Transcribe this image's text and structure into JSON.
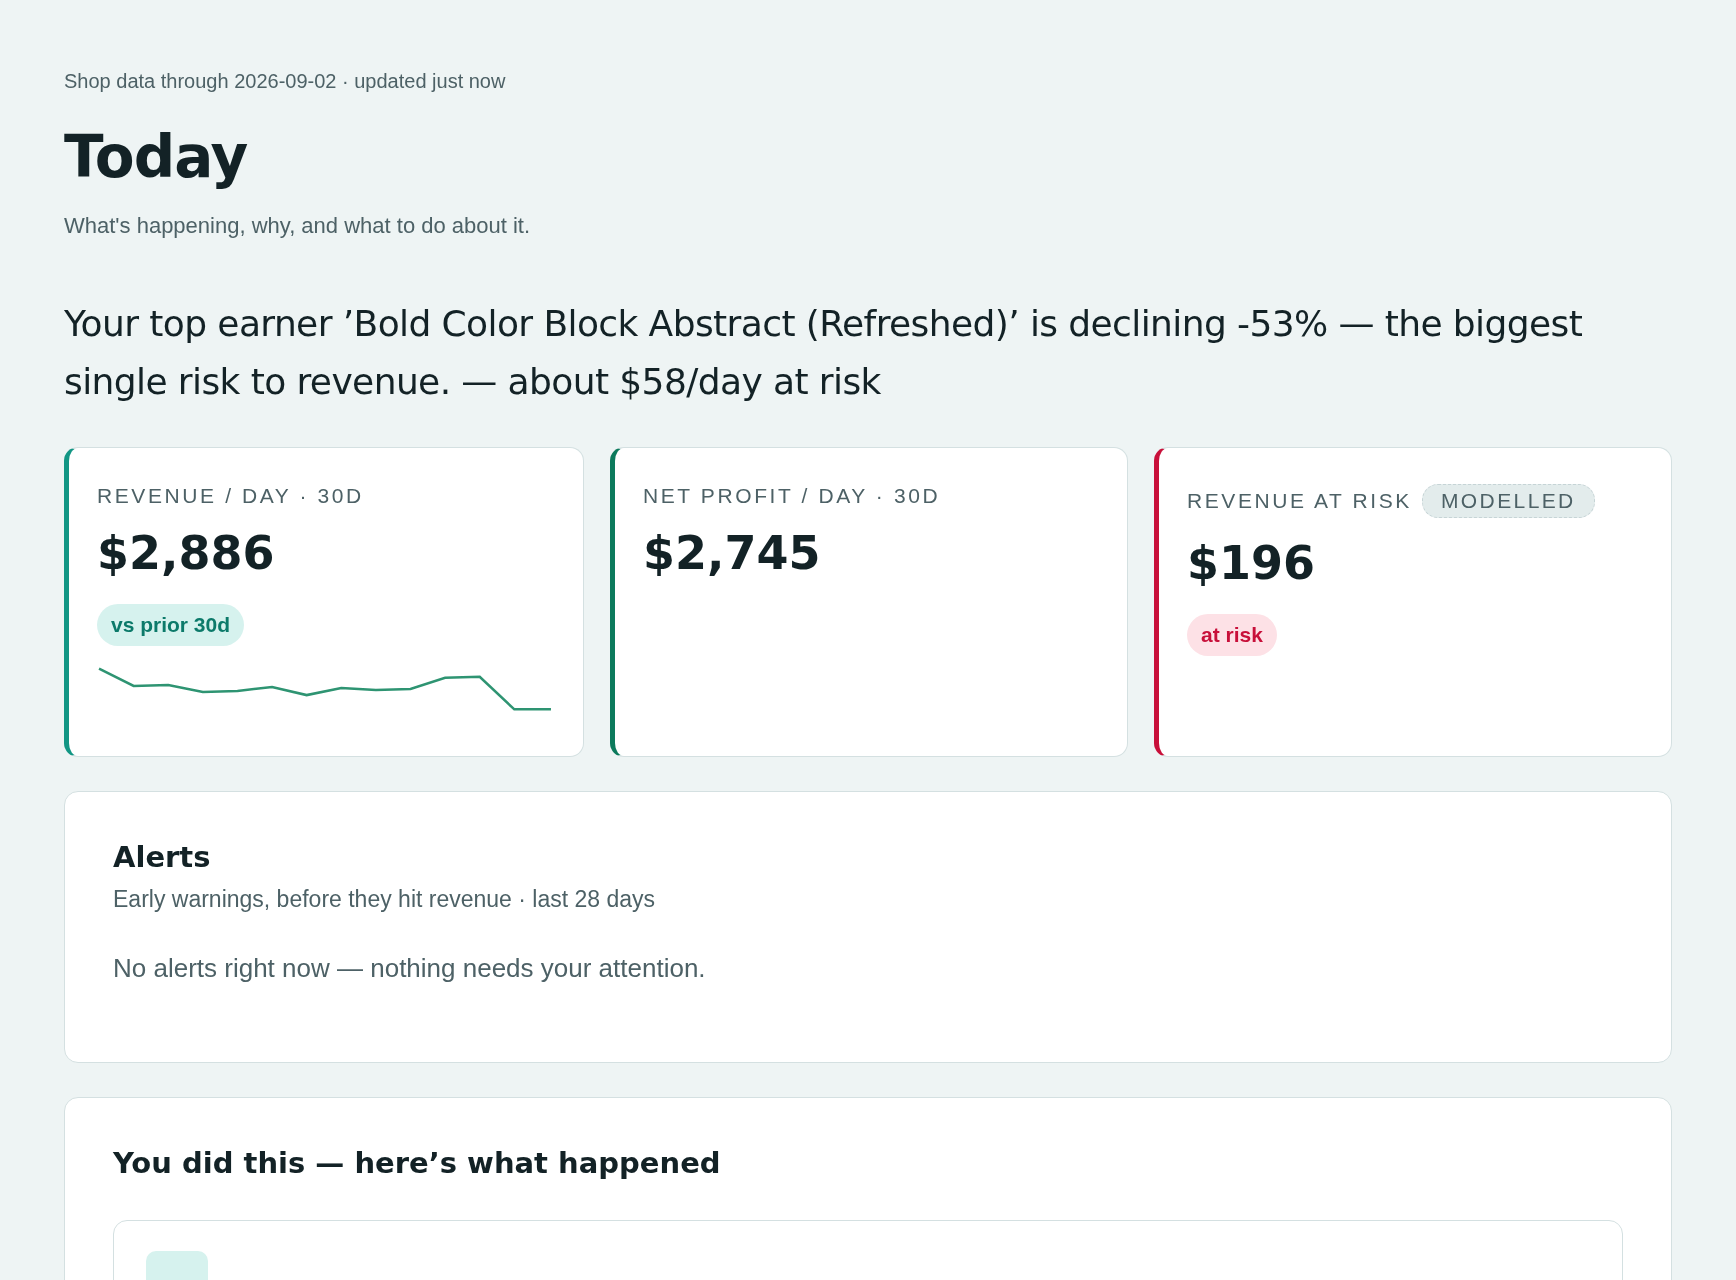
{
  "meta": "Shop data through 2026-09-02 · updated just now",
  "title": "Today",
  "subtitle": "What's happening, why, and what to do about it.",
  "headline": "Your top earner ’Bold Color Block Abstract (Refreshed)’ is declining -53% — the biggest single risk to revenue. — about $58/day at risk",
  "metrics": [
    {
      "label": "REVENUE / DAY · 30D",
      "value": "$2,886",
      "color": "#129684",
      "badge": {
        "text": "vs prior 30d",
        "kind": "good"
      },
      "sparkline": true
    },
    {
      "label": "NET PROFIT / DAY · 30D",
      "value": "$2,745",
      "color": "#0c7a5c"
    },
    {
      "label": "REVENUE AT RISK",
      "tag": "MODELLED",
      "value": "$196",
      "color": "#c8103a",
      "badge": {
        "text": "at risk",
        "kind": "bad"
      }
    }
  ],
  "alerts": {
    "title": "Alerts",
    "subtitle": "Early warnings, before they hit revenue · last 28 days",
    "empty": "No alerts right now — nothing needs your attention."
  },
  "actions": {
    "title": "You did this — here’s what happened"
  }
}
